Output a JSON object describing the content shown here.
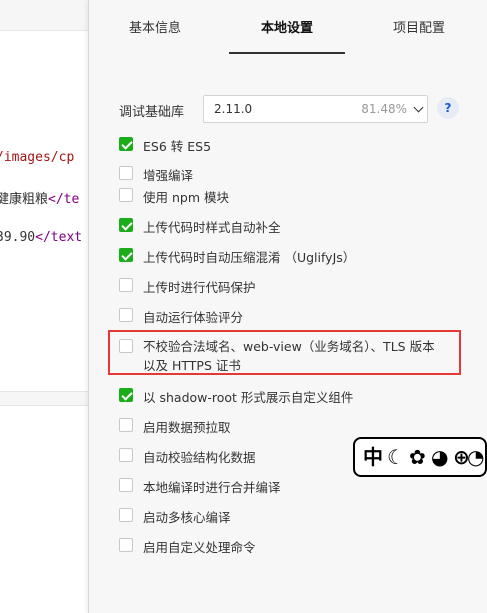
{
  "editor": {
    "lines": [
      {
        "parts": [
          {
            "cls": "str",
            "text": "/images/cp"
          }
        ]
      },
      {
        "parts": [
          {
            "cls": "txt",
            "text": "健康粗粮"
          },
          {
            "cls": "tag",
            "text": "</te"
          }
        ]
      },
      {
        "parts": [
          {
            "cls": "txt",
            "text": "39.90"
          },
          {
            "cls": "tag",
            "text": "</text"
          }
        ]
      }
    ]
  },
  "tabs": [
    {
      "label": "基本信息",
      "active": false
    },
    {
      "label": "本地设置",
      "active": true
    },
    {
      "label": "项目配置",
      "active": false
    }
  ],
  "debug": {
    "label": "调试基础库",
    "version": "2.11.0",
    "percent": "81.48%",
    "help": "?"
  },
  "options": [
    {
      "label": "ES6 转 ES5",
      "checked": true
    },
    {
      "label": "增强编译",
      "checked": false
    },
    {
      "label": "使用 npm 模块",
      "checked": false
    },
    {
      "label": "上传代码时样式自动补全",
      "checked": true
    },
    {
      "label": "上传代码时自动压缩混淆 （UglifyJs）",
      "checked": true
    },
    {
      "label": "上传时进行代码保护",
      "checked": false
    },
    {
      "label": "自动运行体验评分",
      "checked": false
    },
    {
      "label": "不校验合法域名、web-view（业务域名）、TLS 版本以及 HTTPS 证书",
      "checked": false
    },
    {
      "label": "以 shadow-root 形式展示自定义组件",
      "checked": true
    },
    {
      "label": "启用数据预拉取",
      "checked": false
    },
    {
      "label": "自动校验结构化数据",
      "checked": false
    },
    {
      "label": "本地编译时进行合并编译",
      "checked": false
    },
    {
      "label": "启动多核心编译",
      "checked": false
    },
    {
      "label": "启用自定义处理命令",
      "checked": false
    }
  ],
  "sticker": {
    "glyphs": [
      "中",
      "☾",
      "✿",
      "◕",
      "⊕",
      "◔"
    ]
  }
}
